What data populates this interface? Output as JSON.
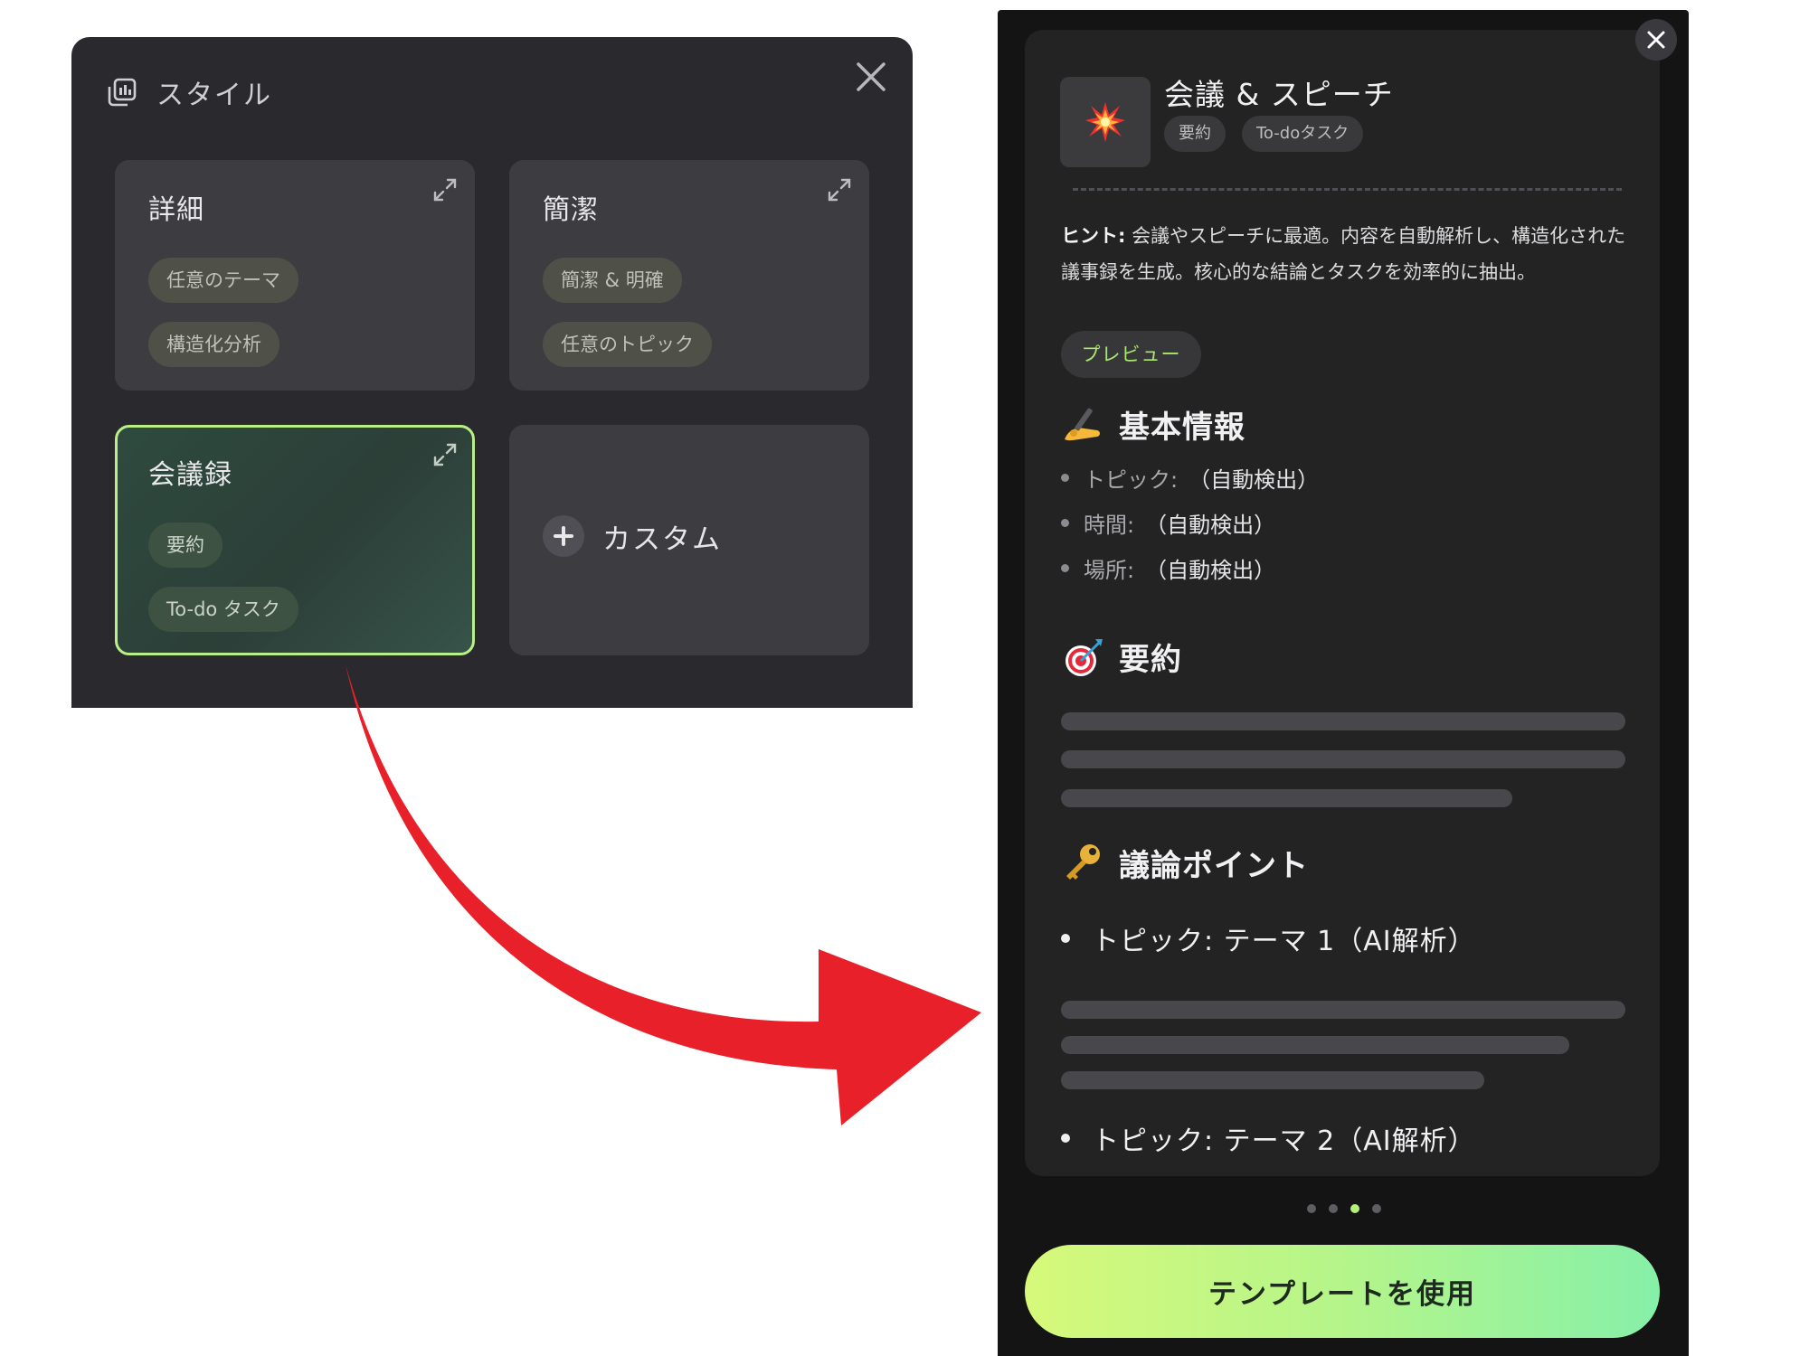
{
  "style_panel": {
    "title": "スタイル",
    "cards": [
      {
        "title": "詳細",
        "chips": [
          "任意のテーマ",
          "構造化分析"
        ]
      },
      {
        "title": "簡潔",
        "chips": [
          "簡潔 & 明確",
          "任意のトピック"
        ]
      },
      {
        "title": "会議録",
        "chips": [
          "要約",
          "To-do タスク"
        ],
        "selected": true
      }
    ],
    "custom_label": "カスタム"
  },
  "preview": {
    "template_name": "会議 & スピーチ",
    "tags": [
      "要約",
      "To-doタスク"
    ],
    "hint_label": "ヒント:",
    "hint_text": "会議やスピーチに最適。内容を自動解析し、構造化された議事録を生成。核心的な結論とタスクを効率的に抽出。",
    "preview_label": "プレビュー",
    "basic_info": {
      "title": "基本情報",
      "rows": [
        {
          "key": "トピック:",
          "value": "（自動検出）"
        },
        {
          "key": "時間:",
          "value": "（自動検出）"
        },
        {
          "key": "場所:",
          "value": "（自動検出）"
        }
      ]
    },
    "summary_title": "要約",
    "points_title": "議論ポイント",
    "topics": [
      "トピック: テーマ 1（AI解析）",
      "トピック: テーマ 2（AI解析）"
    ],
    "use_button": "テンプレートを使用"
  },
  "colors": {
    "accent": "#b4f07a",
    "arrow": "#e8202a",
    "panel_bg": "#2a2a2e",
    "phone_bg": "#141414"
  },
  "icons": [
    "layers-icon",
    "close-icon",
    "expand-icon",
    "plus-icon",
    "explosion-icon",
    "writing-hand-icon",
    "dart-icon",
    "key-icon",
    "arrow-icon"
  ]
}
